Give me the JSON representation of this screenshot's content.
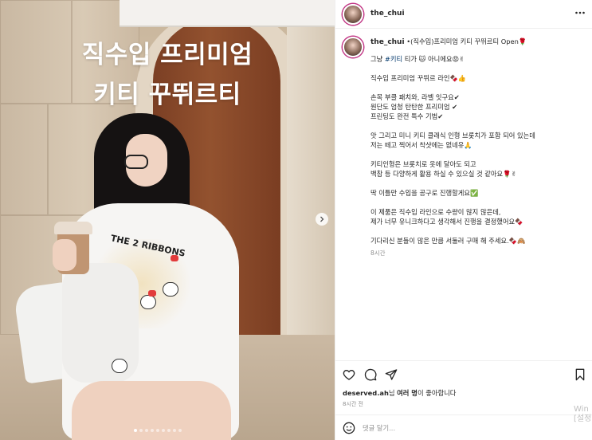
{
  "photo": {
    "overlay_title_line1": "직수입 프리미엄",
    "overlay_title_line2": "키티 꾸뛰르티",
    "shirt_print_text": "THE 2 RIBBONS",
    "next_icon": "chevron-right-icon",
    "carousel_dots": 9,
    "carousel_active_index": 0
  },
  "header": {
    "username": "the_chui",
    "more_icon": "more-horizontal-icon"
  },
  "caption": {
    "username": "the_chui",
    "headline": " •(직수입)프리미엄 키티 꾸뛰르티 Open🌹",
    "lines": [
      {
        "pre": "그냥 ",
        "tag": "#키티",
        "post": " 티가 🐱 아니에요😡✌"
      },
      {
        "gap": true
      },
      {
        "text": "직수입 프리미엄 꾸뛰르 라인🍫👍"
      },
      {
        "gap": true
      },
      {
        "text": "손목 부클 패치와, 라벨 잇구요✔"
      },
      {
        "text": "원단도 엄청 탄탄한 프리미엄 ✔"
      },
      {
        "text": "프린팅도 완전 특수 기법✔"
      },
      {
        "gap": true
      },
      {
        "text": "앗 그리고 미니 키티 클래식 인형 브롯치가 포함 되어 있는데"
      },
      {
        "text": "저는 떼고 찍어서 착샷에는 없네유🙏"
      },
      {
        "gap": true
      },
      {
        "text": "키티인형은 브롯치로 옷에 달아도 되고"
      },
      {
        "text": "백참 등 다양하게 활용 하실 수 있으실 것 같아요🌹✌"
      },
      {
        "gap": true
      },
      {
        "text": "딱 이틀만 수입을 공구로 진행할게요✅"
      },
      {
        "gap": true
      },
      {
        "text": "이 제품은 직수입 라인으로 수량이 많지 않은데,"
      },
      {
        "text": "제가 너무 유니크하다고 생각해서 진행을 결정했어요🍫"
      },
      {
        "gap": true
      },
      {
        "text": "기다리신 분들이 많은 만큼 서둘러 구매 해 주세요.🍫🙈"
      }
    ],
    "time": "8시간"
  },
  "actions": {
    "like_icon": "heart-icon",
    "comment_icon": "comment-icon",
    "share_icon": "send-icon",
    "save_icon": "bookmark-icon"
  },
  "likes": {
    "user": "deserved.ah",
    "connector": "님 ",
    "others": "여러 명",
    "suffix": "이 좋아합니다"
  },
  "post_time": "8시간 전",
  "comment": {
    "emoji_icon": "emoji-icon",
    "placeholder": "댓글 달기..."
  },
  "watermark": {
    "line1": "Win",
    "line2": "[설정"
  },
  "colors": {
    "text": "#262626",
    "secondary": "#8e8e8e",
    "hashtag": "#00376b",
    "border": "#efefef",
    "avatar_ring": "#c13584"
  }
}
